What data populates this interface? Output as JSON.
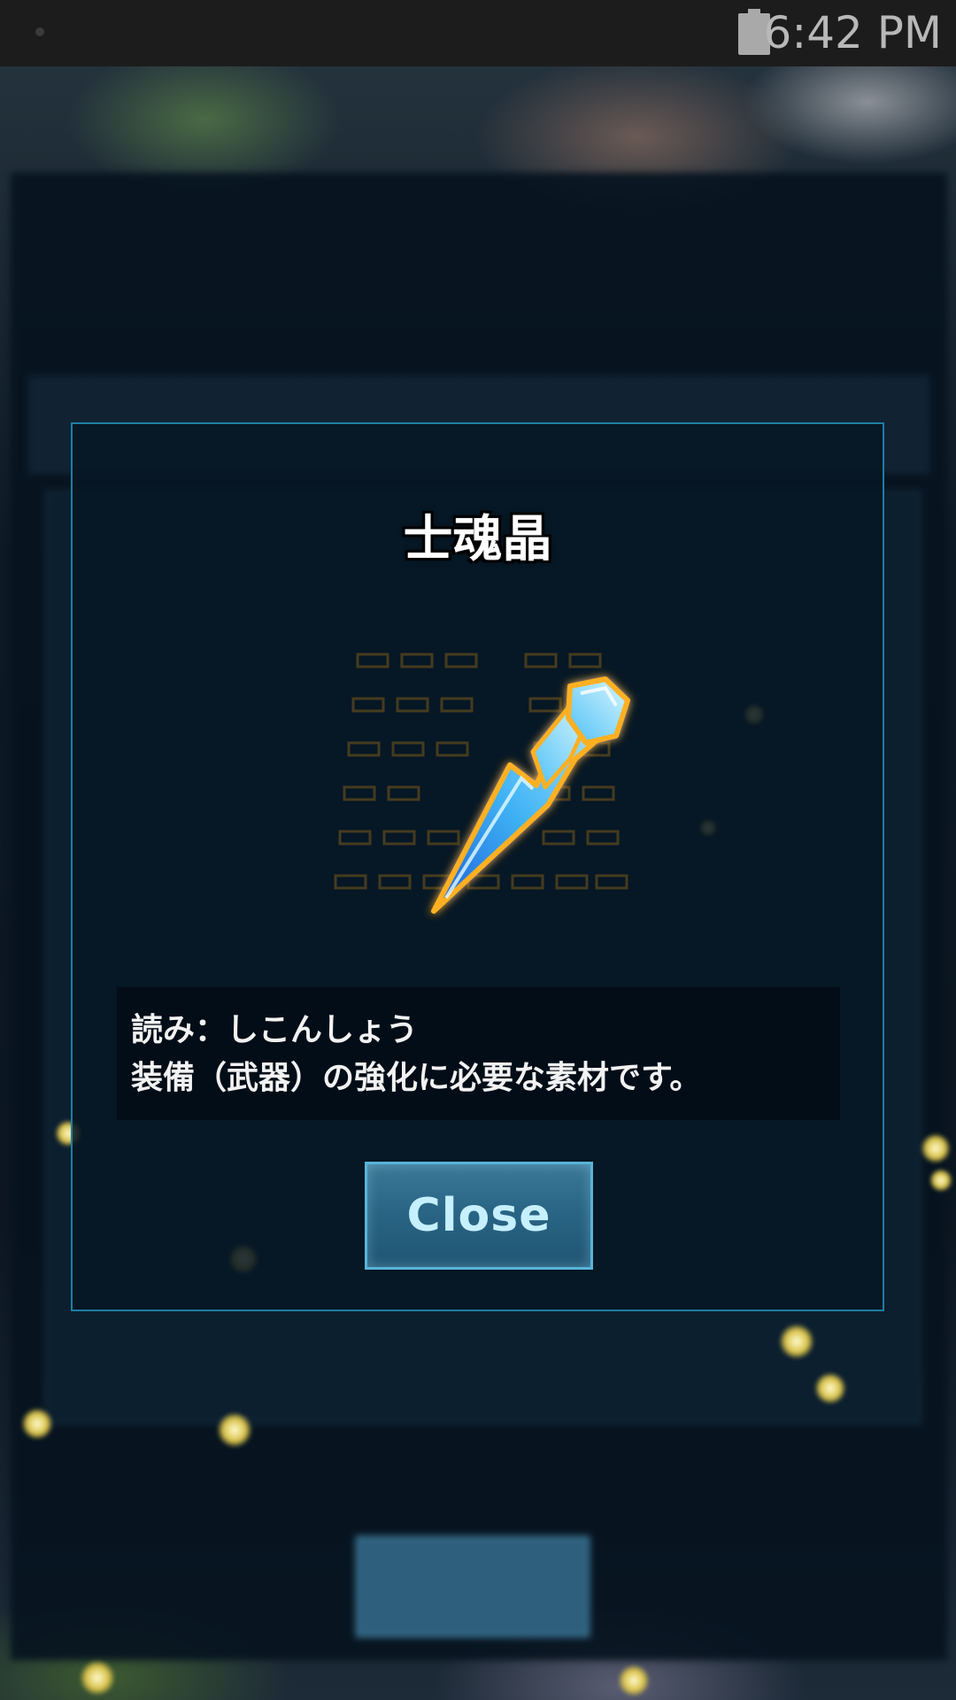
{
  "status_bar": {
    "time": "6:42 PM",
    "battery_icon": "battery-full-icon"
  },
  "dialog": {
    "item_name": "士魂晶",
    "item_icon": "blue-crystal-shard-icon",
    "description_lines": [
      "読み：しこんしょう",
      "装備（武器）の強化に必要な素材です。"
    ],
    "close_label": "Close"
  },
  "colors": {
    "dialog_border": "#1e7ea3",
    "button_fill": "#2a6585",
    "button_text": "#c6f0ff",
    "crystal_glow": "#ffb020",
    "crystal": "#7fd8ff"
  }
}
